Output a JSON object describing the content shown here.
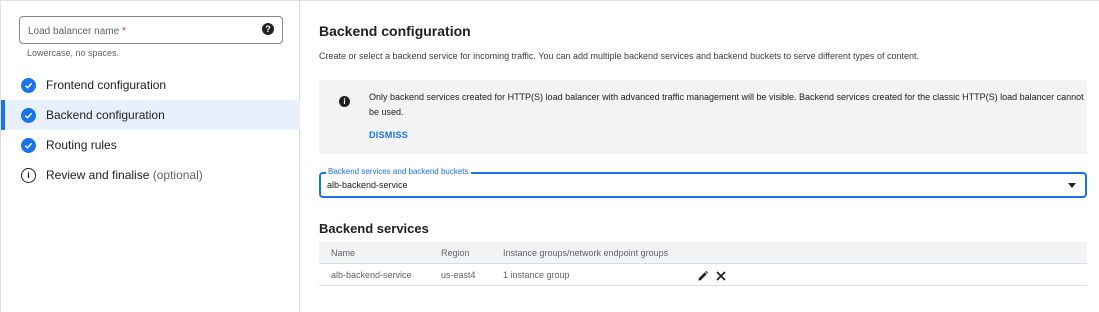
{
  "sidebar": {
    "lb_name": {
      "label": "Load balancer name",
      "required_mark": "*",
      "hint": "Lowercase, no spaces.",
      "help_icon": "help-icon"
    },
    "steps": [
      {
        "label": "Frontend configuration",
        "icon": "check-circle-icon",
        "active": false
      },
      {
        "label": "Backend configuration",
        "icon": "check-circle-icon",
        "active": true
      },
      {
        "label": "Routing rules",
        "icon": "check-circle-icon",
        "active": false
      },
      {
        "label": "Review and finalise",
        "optional": "(optional)",
        "icon": "info-outline-icon",
        "active": false
      }
    ]
  },
  "main": {
    "title": "Backend configuration",
    "description": "Create or select a backend service for incoming traffic. You can add multiple backend services and backend buckets to serve different types of content.",
    "notice": {
      "text": "Only backend services created for HTTP(S) load balancer with advanced traffic management will be visible. Backend services created for the classic HTTP(S) load balancer cannot be used.",
      "dismiss": "DISMISS"
    },
    "select": {
      "label": "Backend services and backend buckets",
      "value": "alb-backend-service"
    },
    "backend_services": {
      "title": "Backend services",
      "columns": [
        "Name",
        "Region",
        "Instance groups/network endpoint groups"
      ],
      "rows": [
        {
          "name": "alb-backend-service",
          "region": "us-east4",
          "groups": "1 instance group"
        }
      ]
    }
  },
  "colors": {
    "accent": "#1a73e8",
    "active_bg": "#e8f0fe",
    "notice_bg": "#f1f3f4"
  }
}
